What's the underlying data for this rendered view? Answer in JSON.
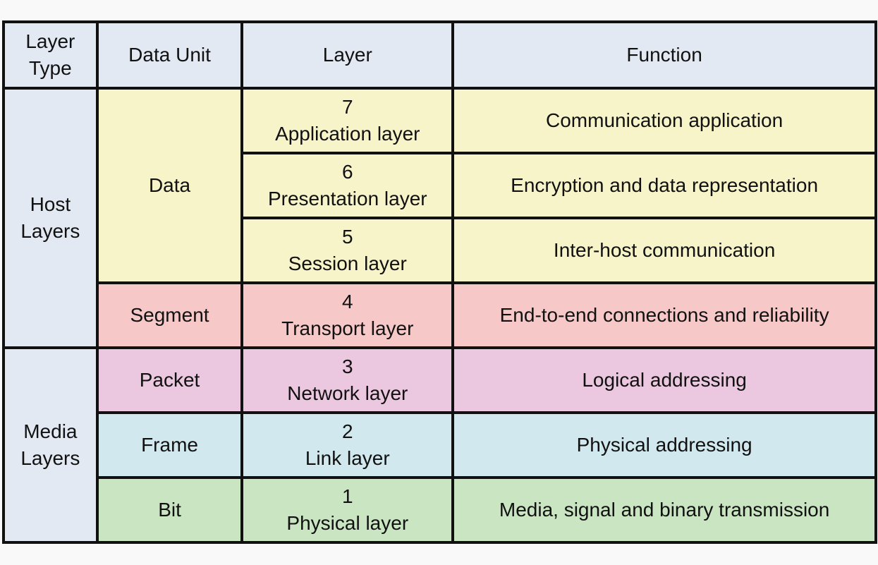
{
  "header": {
    "layer_type": [
      "Layer",
      "Type"
    ],
    "data_unit": "Data Unit",
    "layer": "Layer",
    "function": "Function"
  },
  "groups": {
    "host": [
      "Host",
      "Layers"
    ],
    "media": [
      "Media",
      "Layers"
    ]
  },
  "rows": [
    {
      "num": "7",
      "name": "Application layer",
      "unit": "Data",
      "function": "Communication application"
    },
    {
      "num": "6",
      "name": "Presentation layer",
      "unit": "Data",
      "function": "Encryption and data representation"
    },
    {
      "num": "5",
      "name": "Session layer",
      "unit": "Data",
      "function": "Inter-host communication"
    },
    {
      "num": "4",
      "name": "Transport layer",
      "unit": "Segment",
      "function": "End-to-end connections and reliability"
    },
    {
      "num": "3",
      "name": "Network layer",
      "unit": "Packet",
      "function": "Logical addressing"
    },
    {
      "num": "2",
      "name": "Link layer",
      "unit": "Frame",
      "function": "Physical addressing"
    },
    {
      "num": "1",
      "name": "Physical layer",
      "unit": "Bit",
      "function": "Media, signal and binary transmission"
    }
  ],
  "colors": {
    "header": "#e3e9f3",
    "data": "#f7f4c9",
    "segment": "#f6c8c7",
    "packet": "#ebc8e0",
    "frame": "#d0e8ee",
    "bit": "#cae5c2",
    "border": "#111111"
  }
}
